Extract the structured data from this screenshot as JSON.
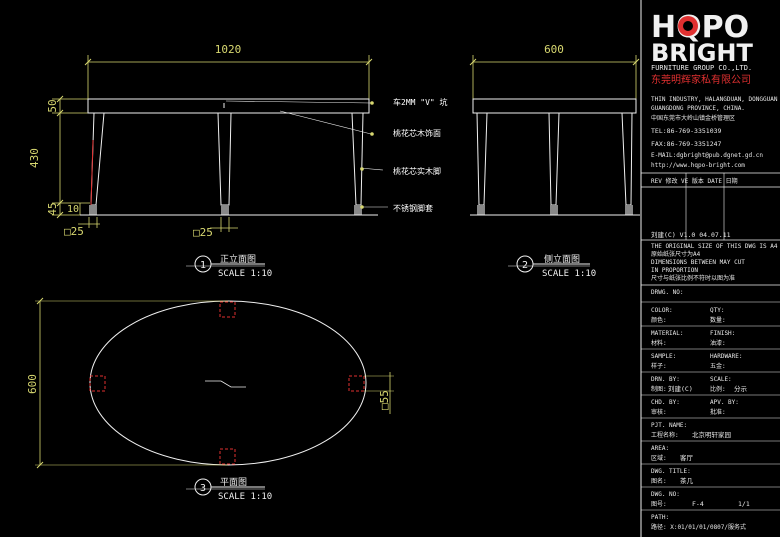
{
  "colors": {
    "background": "#000000",
    "yellow": "#d8d870",
    "white": "#f0f0f0",
    "red": "#e03030",
    "grey": "#9a9a9a"
  },
  "front": {
    "width": "1020",
    "height_total": "430",
    "top_thickness": "50",
    "foot_h": "45",
    "foot_w": "10",
    "leg_left": "□25",
    "leg_center": "□25",
    "view_no": "1",
    "title": "正立面图",
    "scale": "SCALE 1:10"
  },
  "side": {
    "width": "600",
    "view_no": "2",
    "title": "侧立面图",
    "scale": "SCALE 1:10"
  },
  "plan": {
    "depth": "600",
    "leg": "□55",
    "view_no": "3",
    "title": "平面图",
    "scale": "SCALE 1:10"
  },
  "notes": [
    "车2MM \"V\" 坑",
    "桃花芯木饰面",
    "桃花芯实木脚",
    "不锈钢脚套"
  ],
  "logo": {
    "line1": "HQPO",
    "line2": "BRIGHT",
    "company_en": "FURNITURE GROUP CO.,LTD.",
    "company_cn": "东莞明辉家私有限公司"
  },
  "address": [
    "THIN INDUSTRY, HALANGDUAN, DONGGUAN",
    "GUANGDONG PROVINCE, CHINA.",
    "中国东莞市大岭山镇金桥管理区"
  ],
  "contact": {
    "tel": "TEL:86-769-3351039",
    "fax": "FAX:86-769-3351247",
    "email": "E-MAIL:dgbright@pub.dgnet.gd.cn",
    "web": "http://www.hqpo-bright.com"
  },
  "revision": {
    "header": "REV 修改   VE 版本   DATE 日期",
    "row": "刘建(C)   V1.0     04.07.11"
  },
  "notice": [
    "THE ORIGINAL SIZE OF THIS DWG IS A4",
    "原始纸张尺寸为A4",
    "DIMENSIONS BETWEEN MAY CUT",
    "IN PROPORTION",
    "尺寸与纸张比例不符时以图为准"
  ],
  "fields": {
    "drwg_no": "DRWG. NO:",
    "qty_en": "QTY:",
    "color_en": "COLOR:",
    "color_cn": "颜色:",
    "qty_cn": "数量:",
    "material_en": "MATERIAL:",
    "finish_en": "FINISH:",
    "material_cn": "材料:",
    "finish_cn": "油漆:",
    "sample_en": "SAMPLE:",
    "hardware_en": "HARDWARE:",
    "sample_cn": "样子:",
    "hardware_cn": "五金:",
    "drn_by": "DRN. BY:",
    "scale_en": "SCALE:",
    "drn_cn": "制图:",
    "drn_value": "刘建(C)",
    "scale_cn": "比例:",
    "scale_value": "分示",
    "chd_by": "CHD. BY:",
    "apv_by": "APV. BY:",
    "chd_cn": "审核:",
    "apv_cn": "批准:",
    "pjt_name": "PJT. NAME:",
    "pjt_cn": "工程名称:",
    "pjt_value": "北京明轩家园",
    "area_en": "AREA:",
    "area_cn": "区域:",
    "area_value": "客厅",
    "dwg_title": "DWG. TITLE:",
    "title_cn": "图名:",
    "title_value": "茶几",
    "dwg_no2": "DWG. NO:",
    "no_cn": "图号:",
    "no_value": "F-4",
    "sheet": "1/1",
    "path_en": "PATH:",
    "path_value": "路径: X:01/01/01/0807/服务式"
  }
}
